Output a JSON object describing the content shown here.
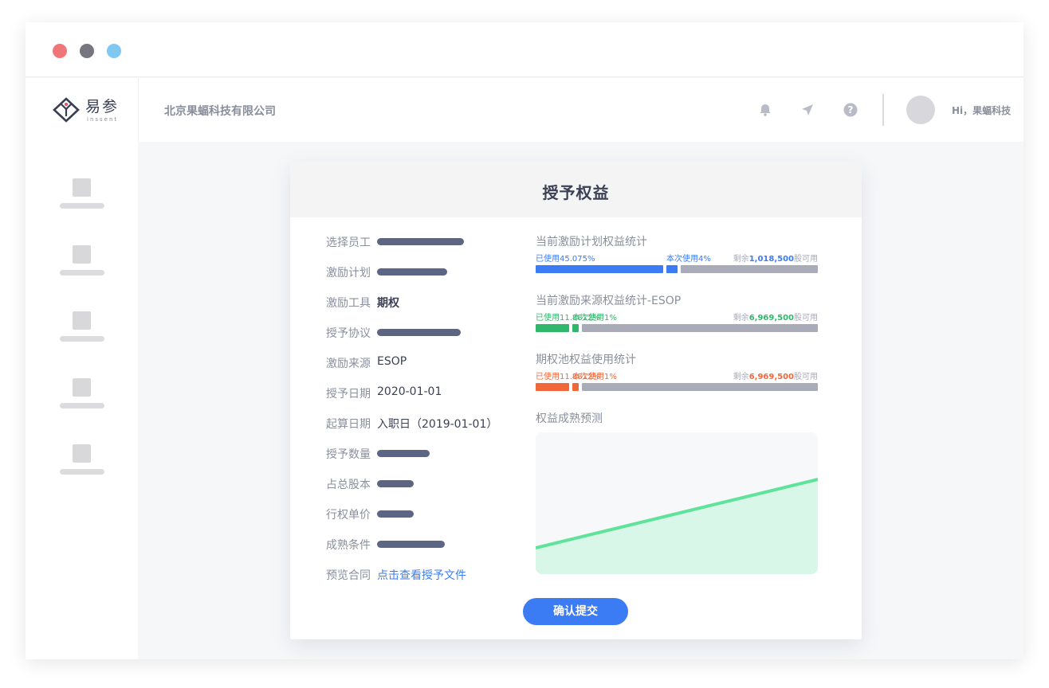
{
  "colors": {
    "used_blue": "#3b7cf4",
    "used_green": "#2fb86a",
    "used_orange": "#f2673a",
    "remaining_gray": "#a9abb8",
    "forecast_line": "#5fe29a",
    "forecast_fill": "#d9f7e8"
  },
  "header": {
    "company": "北京果蝠科技有限公司",
    "greeting": "Hi，果蝠科技",
    "logo": {
      "text": "易参",
      "sub": "inssent"
    },
    "icons": [
      "bell-icon",
      "send-icon",
      "help-icon"
    ]
  },
  "card": {
    "title": "授予权益",
    "fields": [
      {
        "label": "选择员工",
        "value": null
      },
      {
        "label": "激励计划",
        "value": null
      },
      {
        "label": "激励工具",
        "value": "期权"
      },
      {
        "label": "授予协议",
        "value": null
      },
      {
        "label": "激励来源",
        "value": "ESOP"
      },
      {
        "label": "授予日期",
        "value": "2020-01-01"
      },
      {
        "label": "起算日期",
        "value": "入职日（2019-01-01）"
      },
      {
        "label": "授予数量",
        "value": null
      },
      {
        "label": "占总股本",
        "value": null
      },
      {
        "label": "行权单价",
        "value": null
      },
      {
        "label": "成熟条件",
        "value": null
      },
      {
        "label": "预览合同",
        "link": "点击查看授予文件"
      }
    ],
    "stats": [
      {
        "title": "当前激励计划权益统计",
        "used_label": "已使用45.075%",
        "used_fraction": 0.45075,
        "current_label": "本次使用4%",
        "current_fraction": 0.04,
        "remaining_prefix": "剩余",
        "remaining_value": "1,018,500",
        "remaining_suffix": "股可用"
      },
      {
        "title": "当前激励来源权益统计-ESOP",
        "used_label": "已使用11.8812%",
        "used_fraction": 0.118812,
        "current_label": "本次使用1%",
        "current_fraction": 0.01,
        "remaining_prefix": "剩余",
        "remaining_value": "6,969,500",
        "remaining_suffix": "股可用"
      },
      {
        "title": "期权池权益使用统计",
        "used_label": "已使用11.8812%",
        "used_fraction": 0.118812,
        "current_label": "本次使用1%",
        "current_fraction": 0.01,
        "remaining_prefix": "剩余",
        "remaining_value": "6,969,500",
        "remaining_suffix": "股可用"
      }
    ],
    "forecast_title": "权益成熟预测",
    "submit_label": "确认提交"
  }
}
